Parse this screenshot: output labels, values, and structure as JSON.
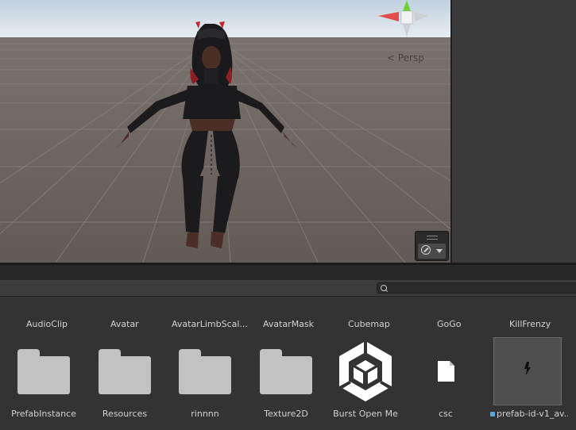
{
  "scene": {
    "persp_label": "< Persp"
  },
  "browser": {
    "search": {
      "value": ""
    },
    "type_filters": [
      "AudioClip",
      "Avatar",
      "AvatarLimbScal...",
      "AvatarMask",
      "Cubemap",
      "GoGo",
      "KillFrenzy"
    ],
    "assets": [
      {
        "label": "PrefabInstance",
        "icon": "folder-icon"
      },
      {
        "label": "Resources",
        "icon": "folder-icon"
      },
      {
        "label": "rinnnn",
        "icon": "folder-icon"
      },
      {
        "label": "Texture2D",
        "icon": "folder-icon"
      },
      {
        "label": "Burst Open Me",
        "icon": "unity-logo-icon"
      },
      {
        "label": "csc",
        "icon": "file-icon"
      },
      {
        "label": "prefab-id-v1_av...",
        "icon": "prefab-icon"
      }
    ]
  },
  "colors": {
    "ground": "#6b635e",
    "sky": "#c7d6e3",
    "panel": "#383838",
    "text": "#d2d2d2"
  }
}
